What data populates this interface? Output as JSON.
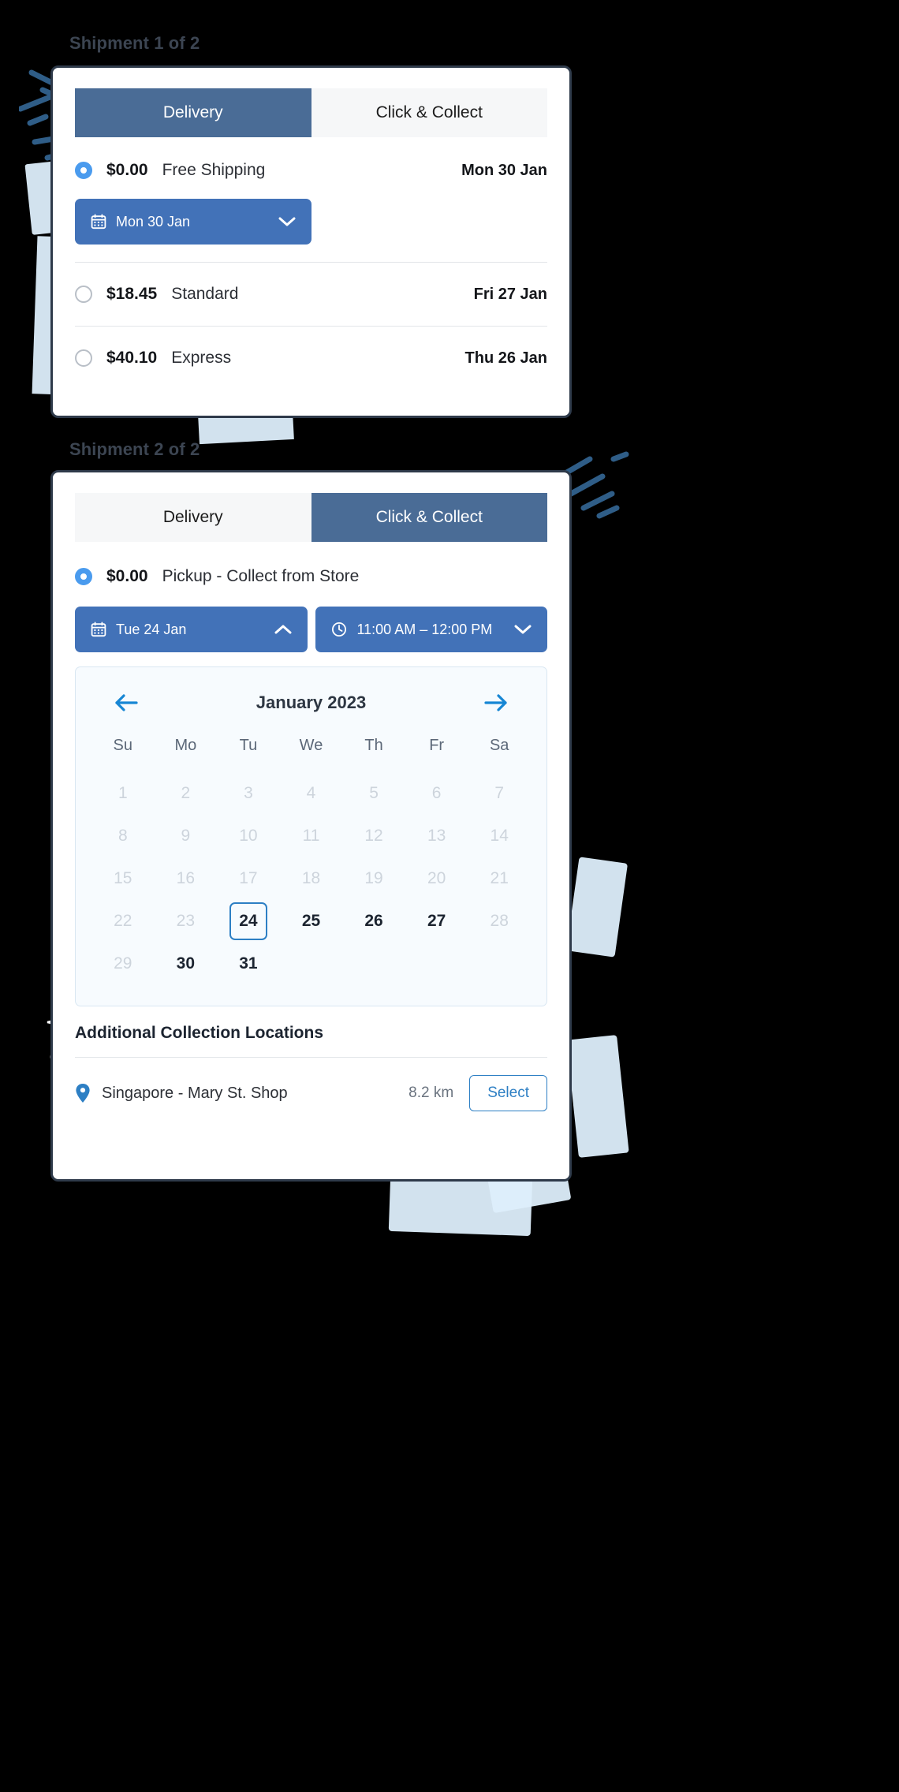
{
  "shipment1": {
    "label": "Shipment 1 of 2",
    "tabs": [
      {
        "label": "Delivery",
        "active": true
      },
      {
        "label": "Click & Collect",
        "active": false
      }
    ],
    "options": [
      {
        "price": "$0.00",
        "name": "Free Shipping",
        "date": "Mon 30 Jan",
        "selected": true
      },
      {
        "price": "$18.45",
        "name": "Standard",
        "date": "Fri 27 Jan",
        "selected": false
      },
      {
        "price": "$40.10",
        "name": "Express",
        "date": "Thu 26 Jan",
        "selected": false
      }
    ],
    "date_pill": {
      "label": "Mon 30 Jan",
      "icon": "calendar-icon",
      "chevron": "chevron-down-icon"
    }
  },
  "shipment2": {
    "label": "Shipment 2 of 2",
    "tabs": [
      {
        "label": "Delivery",
        "active": false
      },
      {
        "label": "Click & Collect",
        "active": true
      }
    ],
    "option": {
      "price": "$0.00",
      "name": "Pickup - Collect from Store",
      "selected": true
    },
    "date_pill": {
      "label": "Tue 24 Jan",
      "icon": "calendar-icon",
      "chevron": "chevron-up-icon"
    },
    "time_pill": {
      "label": "11:00 AM – 12:00 PM",
      "icon": "clock-icon",
      "chevron": "chevron-down-icon"
    },
    "calendar": {
      "title": "January 2023",
      "prev_icon": "arrow-left-icon",
      "next_icon": "arrow-right-icon",
      "weekdays": [
        "Su",
        "Mo",
        "Tu",
        "We",
        "Th",
        "Fr",
        "Sa"
      ],
      "weeks": [
        [
          {
            "d": "1",
            "state": "disabled"
          },
          {
            "d": "2",
            "state": "disabled"
          },
          {
            "d": "3",
            "state": "disabled"
          },
          {
            "d": "4",
            "state": "disabled"
          },
          {
            "d": "5",
            "state": "disabled"
          },
          {
            "d": "6",
            "state": "disabled"
          },
          {
            "d": "7",
            "state": "disabled"
          }
        ],
        [
          {
            "d": "8",
            "state": "disabled"
          },
          {
            "d": "9",
            "state": "disabled"
          },
          {
            "d": "10",
            "state": "disabled"
          },
          {
            "d": "11",
            "state": "disabled"
          },
          {
            "d": "12",
            "state": "disabled"
          },
          {
            "d": "13",
            "state": "disabled"
          },
          {
            "d": "14",
            "state": "disabled"
          }
        ],
        [
          {
            "d": "15",
            "state": "disabled"
          },
          {
            "d": "16",
            "state": "disabled"
          },
          {
            "d": "17",
            "state": "disabled"
          },
          {
            "d": "18",
            "state": "disabled"
          },
          {
            "d": "19",
            "state": "disabled"
          },
          {
            "d": "20",
            "state": "disabled"
          },
          {
            "d": "21",
            "state": "disabled"
          }
        ],
        [
          {
            "d": "22",
            "state": "disabled"
          },
          {
            "d": "23",
            "state": "disabled"
          },
          {
            "d": "24",
            "state": "selected"
          },
          {
            "d": "25",
            "state": "available"
          },
          {
            "d": "26",
            "state": "available"
          },
          {
            "d": "27",
            "state": "available"
          },
          {
            "d": "28",
            "state": "disabled"
          }
        ],
        [
          {
            "d": "29",
            "state": "disabled"
          },
          {
            "d": "30",
            "state": "available"
          },
          {
            "d": "31",
            "state": "available"
          },
          {
            "d": "",
            "state": "empty"
          },
          {
            "d": "",
            "state": "empty"
          },
          {
            "d": "",
            "state": "empty"
          },
          {
            "d": "",
            "state": "empty"
          }
        ]
      ]
    },
    "locations_title": "Additional Collection Locations",
    "locations": [
      {
        "icon": "map-pin-icon",
        "name": "Singapore - Mary St. Shop",
        "distance": "8.2 km",
        "action": "Select"
      }
    ]
  },
  "colors": {
    "tab_active": "#4a6c96",
    "tab_inactive": "#f6f7f8",
    "pill_blue": "#4272b8",
    "radio_blue": "#4a9bee",
    "accent_link": "#2d7fc4",
    "page_bg": "#000000",
    "card_border": "#2e3a4a",
    "deco_blue": "#2f5d87",
    "paper_blue": "#ddeefb"
  }
}
